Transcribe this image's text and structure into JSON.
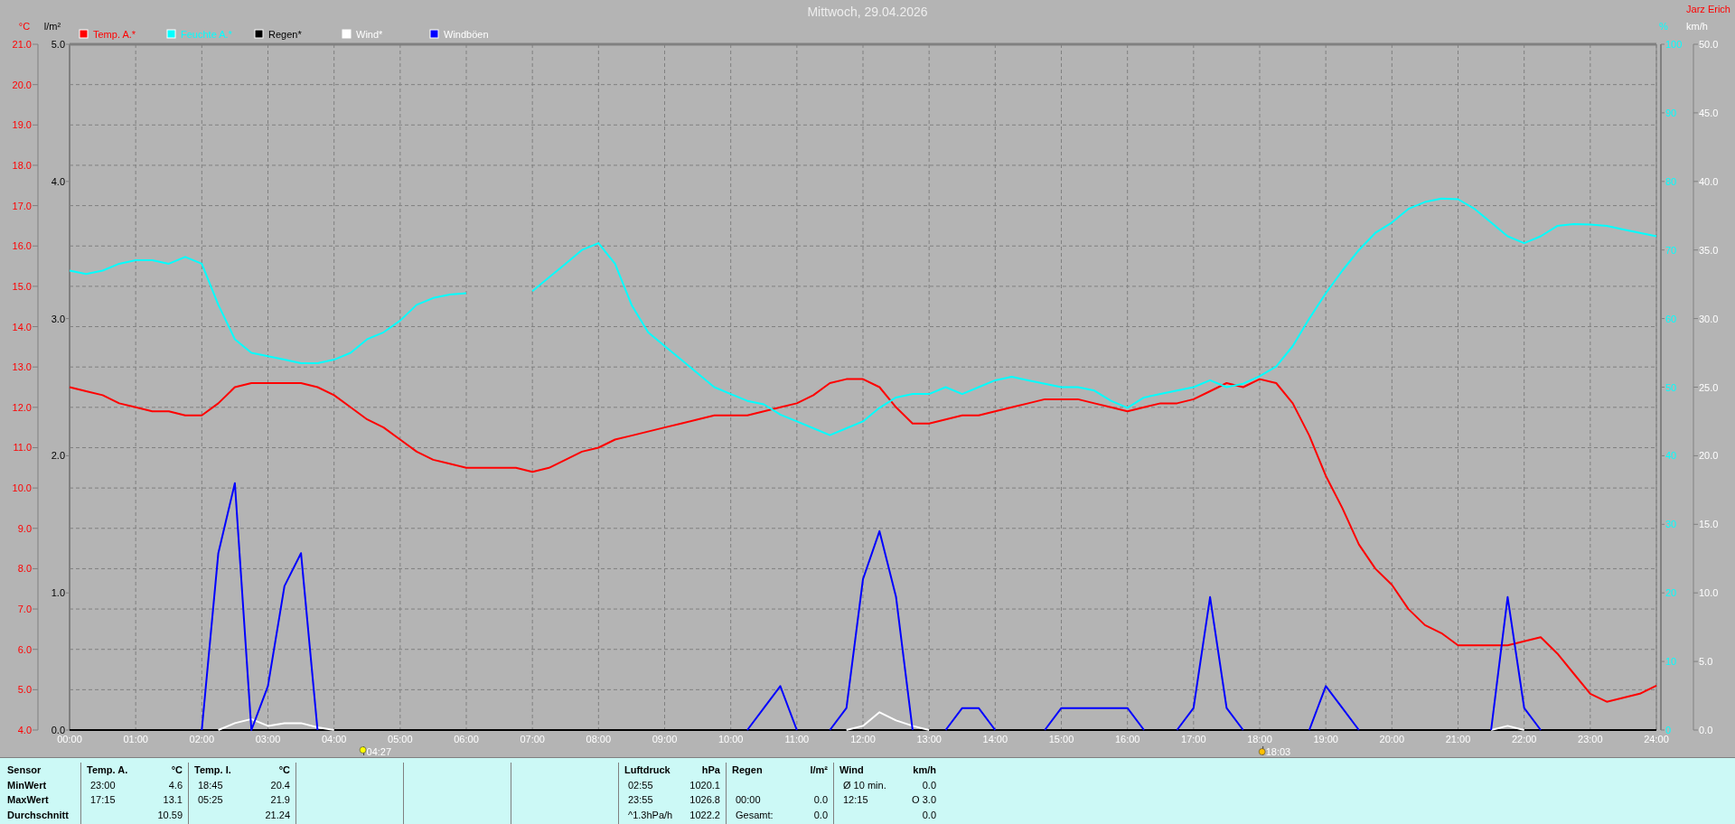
{
  "title": "Mittwoch, 29.04.2026",
  "author": "Jarz Erich",
  "rain_scale": {
    "unit": "l/m²",
    "ticks": [
      "5.0",
      "4.0",
      "3.0",
      "2.0",
      "1.0",
      "0.0"
    ]
  },
  "chart_data": {
    "type": "line",
    "x": [
      0,
      0.25,
      0.5,
      0.75,
      1,
      1.25,
      1.5,
      1.75,
      2,
      2.25,
      2.5,
      2.75,
      3,
      3.25,
      3.5,
      3.75,
      4,
      4.25,
      4.5,
      4.75,
      5,
      5.25,
      5.5,
      5.75,
      6,
      6.25,
      6.5,
      6.75,
      7,
      7.25,
      7.5,
      7.75,
      8,
      8.25,
      8.5,
      8.75,
      9,
      9.25,
      9.5,
      9.75,
      10,
      10.25,
      10.5,
      10.75,
      11,
      11.25,
      11.5,
      11.75,
      12,
      12.25,
      12.5,
      12.75,
      13,
      13.25,
      13.5,
      13.75,
      14,
      14.25,
      14.5,
      14.75,
      15,
      15.25,
      15.5,
      15.75,
      16,
      16.25,
      16.5,
      16.75,
      17,
      17.25,
      17.5,
      17.75,
      18,
      18.25,
      18.5,
      18.75,
      19,
      19.25,
      19.5,
      19.75,
      20,
      20.25,
      20.5,
      20.75,
      21,
      21.25,
      21.5,
      21.75,
      22,
      22.25,
      22.5,
      22.75,
      23,
      23.25,
      23.5,
      23.75,
      24
    ],
    "xlim": [
      0,
      24
    ],
    "xticks": [
      {
        "value": 0,
        "label": "00:00"
      },
      {
        "value": 1,
        "label": "01:00"
      },
      {
        "value": 2,
        "label": "02:00"
      },
      {
        "value": 3,
        "label": "03:00"
      },
      {
        "value": 4,
        "label": "04:00"
      },
      {
        "value": 5,
        "label": "05:00"
      },
      {
        "value": 6,
        "label": "06:00"
      },
      {
        "value": 7,
        "label": "07:00"
      },
      {
        "value": 8,
        "label": "08:00"
      },
      {
        "value": 9,
        "label": "09:00"
      },
      {
        "value": 10,
        "label": "10:00"
      },
      {
        "value": 11,
        "label": "11:00"
      },
      {
        "value": 12,
        "label": "12:00"
      },
      {
        "value": 13,
        "label": "13:00"
      },
      {
        "value": 14,
        "label": "14:00"
      },
      {
        "value": 15,
        "label": "15:00"
      },
      {
        "value": 16,
        "label": "16:00"
      },
      {
        "value": 17,
        "label": "17:00"
      },
      {
        "value": 18,
        "label": "18:00"
      },
      {
        "value": 19,
        "label": "19:00"
      },
      {
        "value": 20,
        "label": "20:00"
      },
      {
        "value": 21,
        "label": "21:00"
      },
      {
        "value": 22,
        "label": "22:00"
      },
      {
        "value": 23,
        "label": "23:00"
      },
      {
        "value": 24,
        "label": "24:00"
      }
    ],
    "ylabel": "°C",
    "ylim": [
      4,
      21
    ],
    "yticks": [
      {
        "value": 4,
        "label": "4.0"
      },
      {
        "value": 5,
        "label": "5.0"
      },
      {
        "value": 6,
        "label": "6.0"
      },
      {
        "value": 7,
        "label": "7.0"
      },
      {
        "value": 8,
        "label": "8.0"
      },
      {
        "value": 9,
        "label": "9.0"
      },
      {
        "value": 10,
        "label": "10.0"
      },
      {
        "value": 11,
        "label": "11.0"
      },
      {
        "value": 12,
        "label": "12.0"
      },
      {
        "value": 13,
        "label": "13.0"
      },
      {
        "value": 14,
        "label": "14.0"
      },
      {
        "value": 15,
        "label": "15.0"
      },
      {
        "value": 16,
        "label": "16.0"
      },
      {
        "value": 17,
        "label": "17.0"
      },
      {
        "value": 18,
        "label": "18.0"
      },
      {
        "value": 19,
        "label": "19.0"
      },
      {
        "value": 20,
        "label": "20.0"
      },
      {
        "value": 21,
        "label": "21.0"
      }
    ],
    "y2label": "%",
    "y2lim": [
      0,
      100
    ],
    "y2ticks": [
      0,
      10,
      20,
      30,
      40,
      50,
      60,
      70,
      80,
      90,
      100
    ],
    "y3label": "km/h",
    "y3lim": [
      0,
      50
    ],
    "y3ticks": [
      {
        "value": 0,
        "label": "0.0"
      },
      {
        "value": 5,
        "label": "5.0"
      },
      {
        "value": 10,
        "label": "10.0"
      },
      {
        "value": 15,
        "label": "15.0"
      },
      {
        "value": 20,
        "label": "20.0"
      },
      {
        "value": 25,
        "label": "25.0"
      },
      {
        "value": 30,
        "label": "30.0"
      },
      {
        "value": 35,
        "label": "35.0"
      },
      {
        "value": 40,
        "label": "40.0"
      },
      {
        "value": 45,
        "label": "45.0"
      },
      {
        "value": 50,
        "label": "50.0"
      }
    ],
    "grid": true,
    "legend": "top",
    "series": [
      {
        "name": "Temp. A.*",
        "color": "#ff0000",
        "values": [
          12.5,
          12.4,
          12.3,
          12.1,
          12.0,
          11.9,
          11.9,
          11.8,
          11.8,
          12.1,
          12.5,
          12.6,
          12.6,
          12.6,
          12.6,
          12.5,
          12.3,
          12.0,
          11.7,
          11.5,
          11.2,
          10.9,
          10.7,
          10.6,
          10.5,
          10.5,
          10.5,
          10.5,
          10.4,
          10.5,
          10.7,
          10.9,
          11.0,
          11.2,
          11.3,
          11.4,
          11.5,
          11.6,
          11.7,
          11.8,
          11.8,
          11.8,
          11.9,
          12.0,
          12.1,
          12.3,
          12.6,
          12.7,
          12.7,
          12.5,
          12.0,
          11.6,
          11.6,
          11.7,
          11.8,
          11.8,
          11.9,
          12.0,
          12.1,
          12.2,
          12.2,
          12.2,
          12.1,
          12.0,
          11.9,
          12.0,
          12.1,
          12.1,
          12.2,
          12.4,
          12.6,
          12.5,
          12.7,
          12.6,
          12.1,
          11.3,
          10.3,
          9.5,
          8.6,
          8.0,
          7.6,
          7.0,
          6.6,
          6.4,
          6.1,
          6.1,
          6.1,
          6.1,
          6.2,
          6.3,
          5.9,
          5.4,
          4.9,
          4.7,
          4.8,
          4.9,
          5.1
        ]
      },
      {
        "name": "Feuchte A.*",
        "color": "#00ffff",
        "axis": "y2",
        "values": [
          67,
          66.5,
          67,
          68,
          68.5,
          68.5,
          68,
          69,
          68,
          62,
          57,
          55,
          54.5,
          54,
          53.5,
          53.5,
          54,
          55,
          57,
          58,
          59.7,
          62,
          63,
          63.5,
          63.7,
          null,
          null,
          null,
          64,
          66,
          68,
          70,
          71,
          68,
          62,
          58,
          56,
          54,
          52,
          50,
          49,
          48,
          47.5,
          46,
          45,
          44,
          43,
          44,
          45,
          47,
          48.5,
          49,
          49,
          50,
          49,
          50,
          51,
          51.5,
          51,
          50.5,
          50,
          50,
          49.5,
          48,
          47,
          48.5,
          49,
          49.5,
          50,
          51,
          50,
          50.5,
          51.6,
          53,
          56,
          60,
          63.7,
          67,
          70,
          72.5,
          74,
          76,
          77,
          77.5,
          77.4,
          76,
          74,
          72,
          71,
          72,
          73.5,
          73.8,
          73.7,
          73.5,
          73,
          72.5,
          72
        ]
      },
      {
        "name": "Regen*",
        "color": "#000000",
        "axis": "y3",
        "values": [
          0,
          0,
          0,
          0,
          0,
          0,
          0,
          0,
          0,
          0,
          0,
          0,
          0,
          0,
          0,
          0,
          0,
          0,
          0,
          0,
          0,
          0,
          0,
          0,
          0,
          0,
          0,
          0,
          0,
          0,
          0,
          0,
          0,
          0,
          0,
          0,
          0,
          0,
          0,
          0,
          0,
          0,
          0,
          0,
          0,
          0,
          0,
          0,
          0,
          0,
          0,
          0,
          0,
          0,
          0,
          0,
          0,
          0,
          0,
          0,
          0,
          0,
          0,
          0,
          0,
          0,
          0,
          0,
          0,
          0,
          0,
          0,
          0,
          0,
          0,
          0,
          0,
          0,
          0,
          0,
          0,
          0,
          0,
          0,
          0,
          0,
          0,
          0,
          0,
          0,
          0,
          0,
          0,
          0,
          0,
          0,
          0
        ]
      },
      {
        "name": "Wind*",
        "color": "#ffffff",
        "axis": "y3",
        "values": [
          null,
          null,
          null,
          null,
          null,
          null,
          null,
          null,
          null,
          0,
          0.5,
          0.8,
          0.3,
          0.5,
          0.5,
          0.2,
          0,
          null,
          null,
          null,
          null,
          null,
          null,
          null,
          null,
          null,
          null,
          null,
          null,
          null,
          null,
          null,
          null,
          null,
          null,
          null,
          null,
          null,
          null,
          null,
          null,
          null,
          null,
          null,
          null,
          null,
          null,
          0,
          0.3,
          1.3,
          0.7,
          0.3,
          0,
          null,
          null,
          null,
          null,
          null,
          null,
          null,
          null,
          null,
          null,
          null,
          null,
          null,
          null,
          null,
          null,
          null,
          null,
          null,
          null,
          null,
          null,
          null,
          null,
          null,
          null,
          null,
          null,
          null,
          null,
          null,
          null,
          null,
          0,
          0.3,
          0,
          null,
          null,
          null,
          null,
          null,
          null,
          null,
          null
        ]
      },
      {
        "name": "Windböen",
        "color": "#0000ff",
        "axis": "y3",
        "values": [
          null,
          null,
          null,
          null,
          null,
          null,
          null,
          null,
          0,
          12.9,
          18,
          0,
          3.2,
          10.5,
          12.9,
          0,
          null,
          null,
          null,
          null,
          null,
          null,
          null,
          null,
          null,
          null,
          null,
          null,
          null,
          null,
          null,
          null,
          null,
          null,
          null,
          null,
          null,
          null,
          null,
          null,
          null,
          0,
          1.6,
          3.2,
          0,
          null,
          0,
          1.6,
          11,
          14.5,
          9.7,
          0,
          null,
          0,
          1.6,
          1.6,
          0,
          null,
          null,
          0,
          1.6,
          1.6,
          1.6,
          1.6,
          1.6,
          0,
          null,
          0,
          1.6,
          9.7,
          1.6,
          0,
          null,
          null,
          null,
          0,
          3.2,
          1.6,
          0,
          null,
          null,
          null,
          null,
          null,
          null,
          null,
          0,
          9.7,
          1.6,
          0,
          null,
          null,
          null,
          null,
          null,
          null,
          null
        ]
      }
    ]
  },
  "sun_times": [
    {
      "kind": "sunrise",
      "time": "04:27"
    },
    {
      "kind": "sunset",
      "time": "18:03"
    }
  ],
  "stats": {
    "labels_header": "Sensor",
    "labels": [
      "MinWert",
      "MaxWert",
      "Durchschnitt"
    ],
    "groups": [
      {
        "name": "Temp. A.",
        "unit": "°C",
        "rows": [
          {
            "time": "23:00",
            "value": "4.6"
          },
          {
            "time": "17:15",
            "value": "13.1"
          },
          {
            "value": "10.59"
          }
        ]
      },
      {
        "name": "Temp. I.",
        "unit": "°C",
        "rows": [
          {
            "time": "18:45",
            "value": "20.4"
          },
          {
            "time": "05:25",
            "value": "21.9"
          },
          {
            "value": "21.24"
          }
        ]
      },
      {
        "kind": "empty"
      },
      {
        "kind": "empty"
      },
      {
        "kind": "empty"
      },
      {
        "name": "Luftdruck",
        "unit": "hPa",
        "rows": [
          {
            "time": "02:55",
            "value": "1020.1"
          },
          {
            "time": "23:55",
            "value": "1026.8"
          },
          {
            "time": "^1.3hPa/h",
            "value": "1022.2"
          }
        ]
      },
      {
        "name": "Regen",
        "unit": "l/m²",
        "rows": [
          {},
          {
            "time": "00:00",
            "value": "0.0"
          },
          {
            "time": "Gesamt:",
            "value": "0.0"
          }
        ]
      },
      {
        "name": "Wind",
        "unit": "km/h",
        "rows": [
          {
            "time": "Ø 10 min.",
            "value": "0.0"
          },
          {
            "time": "12:15",
            "value": "O 3.0"
          },
          {
            "value": "0.0"
          }
        ]
      }
    ]
  }
}
